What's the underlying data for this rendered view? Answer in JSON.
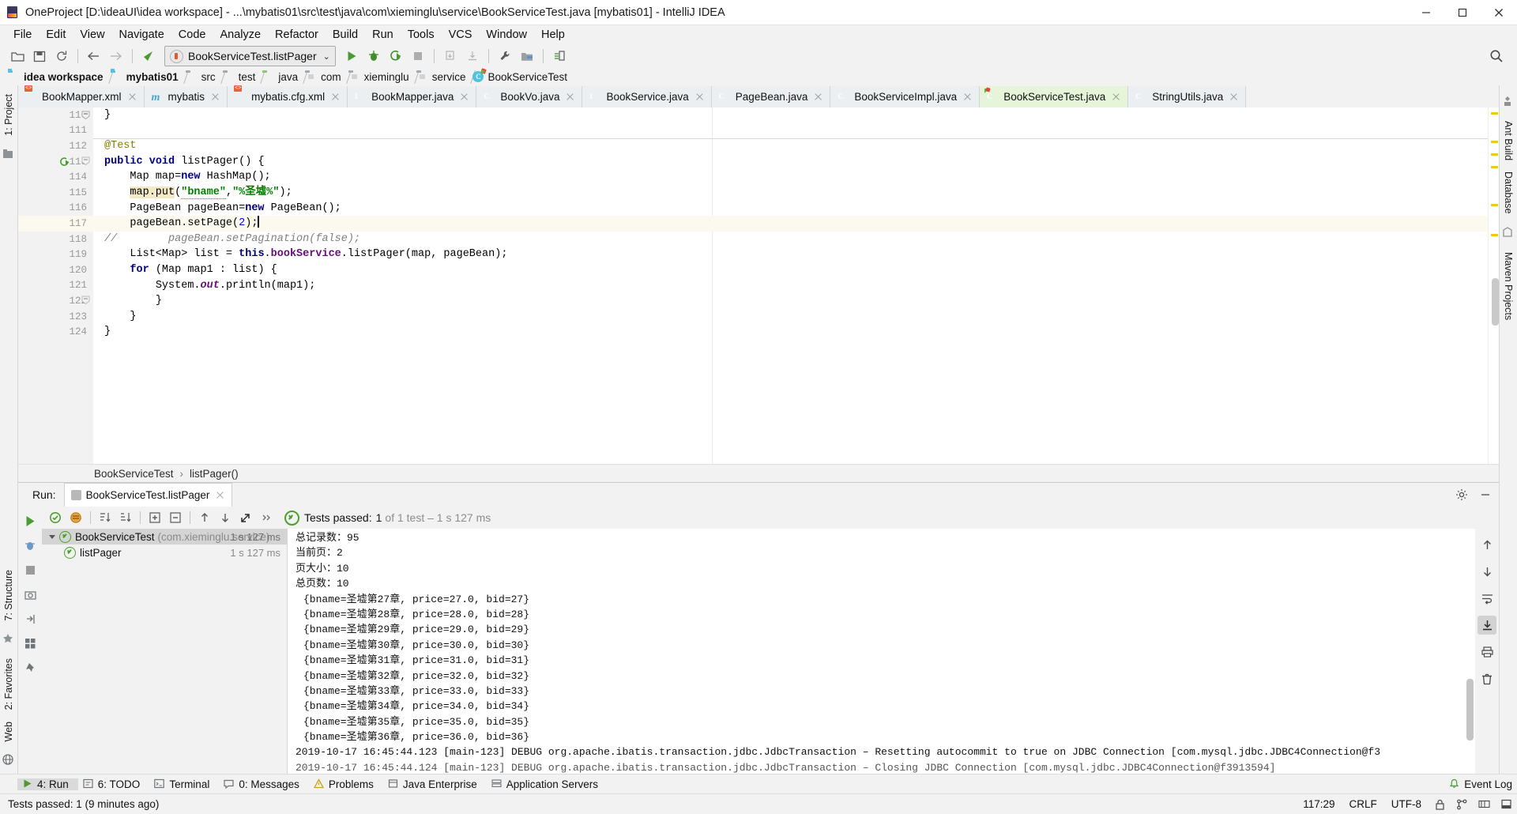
{
  "window": {
    "title": "OneProject [D:\\ideaUI\\idea workspace] - ...\\mybatis01\\src\\test\\java\\com\\xieminglu\\service\\BookServiceTest.java [mybatis01] - IntelliJ IDEA",
    "minimize": "minimize-icon",
    "maximize": "maximize-icon",
    "close": "close-icon"
  },
  "menubar": {
    "items": [
      {
        "label": "File"
      },
      {
        "label": "Edit"
      },
      {
        "label": "View"
      },
      {
        "label": "Navigate"
      },
      {
        "label": "Code"
      },
      {
        "label": "Analyze"
      },
      {
        "label": "Refactor"
      },
      {
        "label": "Build"
      },
      {
        "label": "Run"
      },
      {
        "label": "Tools"
      },
      {
        "label": "VCS"
      },
      {
        "label": "Window"
      },
      {
        "label": "Help"
      }
    ]
  },
  "toolbar": {
    "run_config": "BookServiceTest.listPager",
    "icons": [
      "open-folder-icon",
      "save-all-icon",
      "sync-icon",
      "back-arrow-icon",
      "forward-arrow-icon",
      "undo-icon",
      "run-icon",
      "debug-icon",
      "run-coverage-icon",
      "stop-icon",
      "update-project-icon",
      "commit-icon",
      "wrench-icon",
      "project-structure-icon",
      "build-icon",
      "search-everywhere-icon"
    ]
  },
  "breadcrumb": {
    "items": [
      {
        "label": "idea workspace",
        "icon": "module-folder-icon",
        "bold": true
      },
      {
        "label": "mybatis01",
        "icon": "module-folder-icon",
        "bold": true
      },
      {
        "label": "src",
        "icon": "folder-icon",
        "bold": false
      },
      {
        "label": "test",
        "icon": "folder-icon",
        "bold": false
      },
      {
        "label": "java",
        "icon": "source-folder-icon",
        "bold": false
      },
      {
        "label": "com",
        "icon": "package-icon",
        "bold": false
      },
      {
        "label": "xieminglu",
        "icon": "package-icon",
        "bold": false
      },
      {
        "label": "service",
        "icon": "package-icon",
        "bold": false
      },
      {
        "label": "BookServiceTest",
        "icon": "test-class-icon",
        "bold": false
      }
    ]
  },
  "editor_tabs": [
    {
      "label": "BookMapper.xml",
      "icon": "xml-file-icon",
      "active": false
    },
    {
      "label": "mybatis",
      "icon": "mybatis-icon",
      "active": false
    },
    {
      "label": "mybatis.cfg.xml",
      "icon": "xml-file-icon",
      "active": false
    },
    {
      "label": "BookMapper.java",
      "icon": "interface-icon",
      "active": false
    },
    {
      "label": "BookVo.java",
      "icon": "class-icon",
      "active": false
    },
    {
      "label": "BookService.java",
      "icon": "interface-icon",
      "active": false
    },
    {
      "label": "PageBean.java",
      "icon": "class-icon",
      "active": false
    },
    {
      "label": "BookServiceImpl.java",
      "icon": "class-icon",
      "active": false
    },
    {
      "label": "BookServiceTest.java",
      "icon": "test-class-icon",
      "active": true
    },
    {
      "label": "StringUtils.java",
      "icon": "class-icon",
      "active": false
    }
  ],
  "editor": {
    "lines": [
      {
        "num": "110",
        "current": false
      },
      {
        "num": "111",
        "current": false
      },
      {
        "num": "112",
        "current": false
      },
      {
        "num": "113",
        "current": false
      },
      {
        "num": "114",
        "current": false
      },
      {
        "num": "115",
        "current": false
      },
      {
        "num": "116",
        "current": false
      },
      {
        "num": "117",
        "current": true
      },
      {
        "num": "118",
        "current": false
      },
      {
        "num": "119",
        "current": false
      },
      {
        "num": "120",
        "current": false
      },
      {
        "num": "121",
        "current": false
      },
      {
        "num": "122",
        "current": false
      },
      {
        "num": "123",
        "current": false
      },
      {
        "num": "124",
        "current": false
      }
    ],
    "code_text": {
      "l110": "}",
      "l112": "@Test",
      "l113_kw1": "public",
      "l113_kw2": "void",
      "l113_name": "listPager",
      "l113_tail": "() {",
      "l114": "Map map=",
      "l114_kw": "new",
      "l114_tail": " HashMap();",
      "l115_hl": "map.put",
      "l115_open": "(",
      "l115_s1": "\"bname\"",
      "l115_comma": ",",
      "l115_s2": "\"%圣墟%\"",
      "l115_close": ");",
      "l116_a": "PageBean pageBean=",
      "l116_kw": "new",
      "l116_b": " PageBean();",
      "l117_a": "pageBean.setPage(",
      "l117_n": "2",
      "l117_b": ");",
      "l118_slashes": "//",
      "l118": "pageBean.setPagination(false);",
      "l119_a": "List<Map> list = ",
      "l119_this": "this",
      "l119_dot": ".",
      "l119_fld": "bookService",
      "l119_b": ".listPager(map, pageBean);",
      "l120_kw": "for",
      "l120_b": " (Map map1 : list) {",
      "l121": "System.",
      "l121_fld": "out",
      "l121_b": ".println(map1);",
      "l122": "}",
      "l123": "}",
      "l124": "}"
    },
    "bottom_breadcrumb": {
      "class": "BookServiceTest",
      "separator": "›",
      "method": "listPager()"
    }
  },
  "left_rail": {
    "items": [
      {
        "label": "1: Project"
      },
      {
        "label": "7: Structure"
      },
      {
        "label": "2: Favorites"
      },
      {
        "label": "Web"
      }
    ]
  },
  "right_rail": {
    "items": [
      {
        "label": "Ant Build"
      },
      {
        "label": "Database"
      },
      {
        "label": "Maven Projects"
      }
    ]
  },
  "run_panel": {
    "title": "Run:",
    "tab_label": "BookServiceTest.listPager",
    "status": {
      "prefix": "Tests passed:",
      "count": "1",
      "suffix": "of 1 test – 1 s 127 ms"
    },
    "toolbar_icons": [
      "rerun-icon",
      "rerun-failed-icon",
      "toggle-auto-test-icon",
      "sort-alpha-icon",
      "sort-duration-icon",
      "expand-all-icon",
      "collapse-all-icon",
      "prev-failed-icon",
      "next-failed-icon",
      "export-icon",
      "more-icon"
    ],
    "tree": [
      {
        "label": "BookServiceTest",
        "package": "(com.xieminglu.service)",
        "time": "1 s 127 ms",
        "selected": true,
        "depth": 0
      },
      {
        "label": "listPager",
        "package": "",
        "time": "1 s 127 ms",
        "selected": false,
        "depth": 1
      }
    ],
    "console": [
      "总记录数：95",
      "当前页：2",
      "页大小：10",
      "总页数：10",
      "{bname=圣墟第27章, price=27.0, bid=27}",
      "{bname=圣墟第28章, price=28.0, bid=28}",
      "{bname=圣墟第29章, price=29.0, bid=29}",
      "{bname=圣墟第30章, price=30.0, bid=30}",
      "{bname=圣墟第31章, price=31.0, bid=31}",
      "{bname=圣墟第32章, price=32.0, bid=32}",
      "{bname=圣墟第33章, price=33.0, bid=33}",
      "{bname=圣墟第34章, price=34.0, bid=34}",
      "{bname=圣墟第35章, price=35.0, bid=35}",
      "{bname=圣墟第36章, price=36.0, bid=36}",
      "2019-10-17 16:45:44.123 [main-123] DEBUG org.apache.ibatis.transaction.jdbc.JdbcTransaction – Resetting autocommit to true on JDBC Connection [com.mysql.jdbc.JDBC4Connection@f3",
      "2019-10-17 16:45:44.124 [main-123] DEBUG org.apache.ibatis.transaction.jdbc.JdbcTransaction – Closing JDBC Connection [com.mysql.jdbc.JDBC4Connection@f3913594]"
    ],
    "side_icons": [
      "rerun-icon",
      "debug-icon",
      "stop-icon",
      "camera-icon",
      "import-icon",
      "grid-icon",
      "pin-icon"
    ],
    "console_icons": [
      "scroll-up-icon",
      "scroll-down-icon",
      "soft-wrap-icon",
      "scroll-to-end-icon",
      "print-icon",
      "trash-icon"
    ]
  },
  "tool_windows": [
    {
      "label": "4: Run",
      "icon": "run-icon",
      "active": true
    },
    {
      "label": "6: TODO",
      "icon": "todo-icon",
      "active": false
    },
    {
      "label": "Terminal",
      "icon": "terminal-icon",
      "active": false
    },
    {
      "label": "0: Messages",
      "icon": "messages-icon",
      "active": false
    },
    {
      "label": "Problems",
      "icon": "problems-icon",
      "active": false
    },
    {
      "label": "Java Enterprise",
      "icon": "java-enterprise-icon",
      "active": false
    },
    {
      "label": "Application Servers",
      "icon": "app-servers-icon",
      "active": false
    }
  ],
  "event_log": {
    "label": "Event Log",
    "icon": "bell-icon"
  },
  "status_bar": {
    "message": "Tests passed: 1 (9 minutes ago)",
    "caret": "117:29",
    "line_sep": "CRLF",
    "encoding": "UTF-8",
    "indent_caret": "÷",
    "icons": [
      "lock-icon",
      "branch-icon",
      "memory-icon",
      "hide-icon"
    ]
  },
  "colors": {
    "accent_green": "#5a9b3c",
    "active_tab_bg": "#e6f5da",
    "current_line": "#fcfaef",
    "highlight": "#f2e9c5",
    "keyword": "#000080",
    "string": "#008000",
    "annotation": "#808000",
    "field": "#660e7a",
    "comment": "#808080",
    "number": "#0000ff",
    "stripe": "#f5c518"
  }
}
